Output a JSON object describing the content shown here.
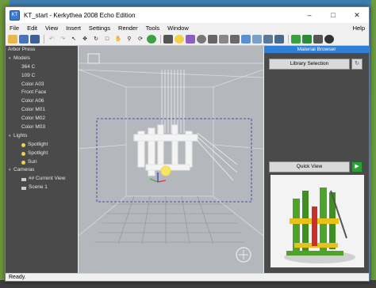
{
  "window": {
    "title": "KT_start - Kerkythea 2008 Echo Edition",
    "app_icon_label": "KT"
  },
  "menu": [
    "File",
    "Edit",
    "View",
    "Insert",
    "Settings",
    "Render",
    "Tools",
    "Window"
  ],
  "menu_help": "Help",
  "toolbar_icons": [
    "open-folder-icon",
    "save-icon",
    "save-as-icon",
    "undo-icon",
    "redo-icon",
    "select-icon",
    "move-icon",
    "rotate-icon",
    "scale-icon",
    "hand-icon",
    "zoom-icon",
    "orbit-icon",
    "render-icon",
    "camera-icon",
    "light-icon",
    "material-icon",
    "sphere-icon",
    "cube-icon",
    "plane-icon",
    "cylinder-icon",
    "settings-icon",
    "grid-icon",
    "axes-icon",
    "wire-icon",
    "box-icon",
    "solid-icon",
    "image-icon",
    "export-icon",
    "help-icon"
  ],
  "scene_tree": {
    "root": "Arbor Press",
    "models_label": "Models",
    "models": [
      "364 C",
      "109 C",
      "Color A03",
      "Front Face",
      "Color A06",
      "Color M01",
      "Color M02",
      "Color M03"
    ],
    "lights_label": "Lights",
    "lights": [
      "Spotlight",
      "Spotlight",
      "Sun"
    ],
    "cameras_label": "Cameras",
    "cameras": [
      "## Current View",
      "Scene 1"
    ]
  },
  "material_browser": {
    "title": "Material Browser",
    "library_button": "Library Selection",
    "quick_view_button": "Quick View"
  },
  "status": {
    "text": "Ready."
  },
  "colors": {
    "accent": "#2e7fd6",
    "panel_bg": "#4a4a4a",
    "viewport_bg": "#b4b8bc",
    "model_green": "#4fa32a",
    "model_yellow": "#e8c21a",
    "model_red": "#c9302c"
  }
}
